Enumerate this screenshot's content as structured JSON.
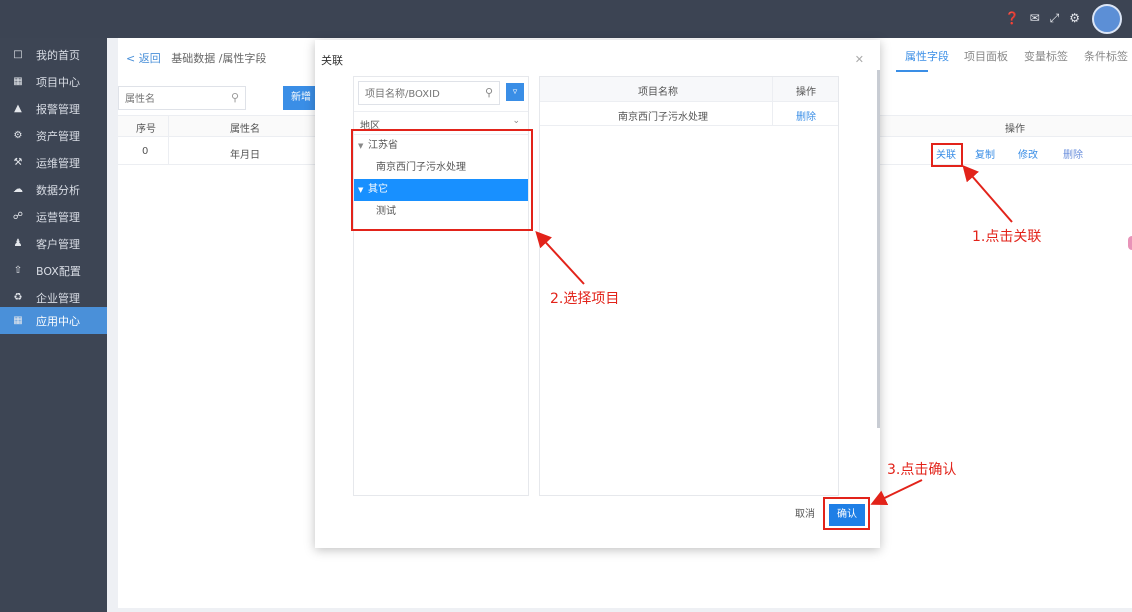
{
  "topbar": {
    "icons": [
      "help-icon",
      "mail-icon",
      "fullscreen-icon",
      "settings-icon"
    ],
    "avatar": "avatar"
  },
  "sidebar": {
    "items": [
      {
        "label": "我的首页",
        "icon": "monitor-icon"
      },
      {
        "label": "项目中心",
        "icon": "grid-icon"
      },
      {
        "label": "报警管理",
        "icon": "bell-icon"
      },
      {
        "label": "资产管理",
        "icon": "gear-icon"
      },
      {
        "label": "运维管理",
        "icon": "wrench-icon"
      },
      {
        "label": "数据分析",
        "icon": "cloud-icon"
      },
      {
        "label": "运营管理",
        "icon": "link-icon"
      },
      {
        "label": "客户管理",
        "icon": "users-icon"
      },
      {
        "label": "BOX配置",
        "icon": "upload-icon"
      },
      {
        "label": "企业管理",
        "icon": "org-icon"
      },
      {
        "label": "应用中心",
        "icon": "apps-icon",
        "active": true
      }
    ]
  },
  "main": {
    "breadcrumb": {
      "back": "< 返回",
      "path": "基础数据 /属性字段"
    },
    "tabs": [
      "属性字段",
      "项目面板",
      "变量标签",
      "条件标签"
    ],
    "search_placeholder": "属性名",
    "new_button": "新增",
    "columns": {
      "index": "序号",
      "name": "属性名",
      "ops": "操作"
    },
    "rows": [
      {
        "index": "0",
        "name": "年月日",
        "ops": [
          "关联",
          "复制",
          "修改",
          "删除"
        ]
      }
    ]
  },
  "modal": {
    "title": "关联",
    "search_placeholder": "项目名称/BOXID",
    "region_label": "地区",
    "tree": [
      {
        "label": "江苏省",
        "type": "group"
      },
      {
        "label": "南京西门子污水处理",
        "type": "leaf"
      },
      {
        "label": "其它",
        "type": "group",
        "selected": true
      },
      {
        "label": "测试",
        "type": "leaf"
      }
    ],
    "table_head": {
      "name": "项目名称",
      "ops": "操作"
    },
    "table_rows": [
      {
        "name": "南京西门子污水处理",
        "op": "删除"
      }
    ],
    "cancel": "取消",
    "confirm": "确认"
  },
  "annotations": {
    "step1": "1.点击关联",
    "step2": "2.选择项目",
    "step3": "3.点击确认",
    "color": "#e2231a"
  }
}
